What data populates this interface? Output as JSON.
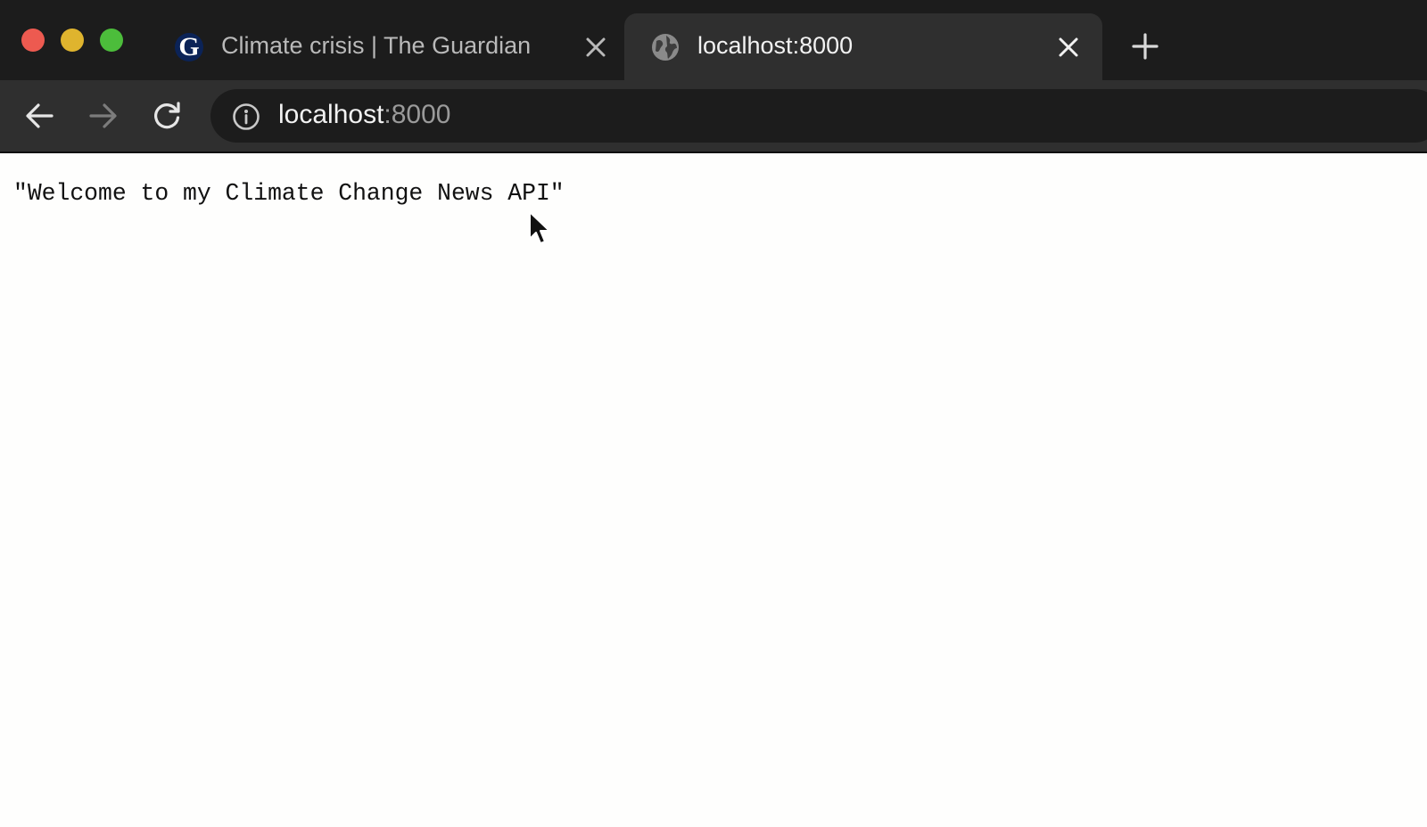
{
  "browser": {
    "tabs": [
      {
        "title": "Climate crisis | The Guardian",
        "favicon": "guardian-g-icon",
        "favicon_letter": "G",
        "active": false
      },
      {
        "title": "localhost:8000",
        "favicon": "globe-icon",
        "active": true
      }
    ],
    "address_bar": {
      "host": "localhost",
      "port": ":8000"
    }
  },
  "page": {
    "body_text": "\"Welcome to my Climate Change News API\""
  },
  "colors": {
    "tabstrip": "#1c1c1c",
    "active_tab": "#2f2f2f",
    "traffic_red": "#ed5a50",
    "traffic_yellow": "#dfb42e",
    "traffic_green": "#4cbd3b",
    "guardian_blue": "#0b2357",
    "page_background": "#fefefd"
  }
}
